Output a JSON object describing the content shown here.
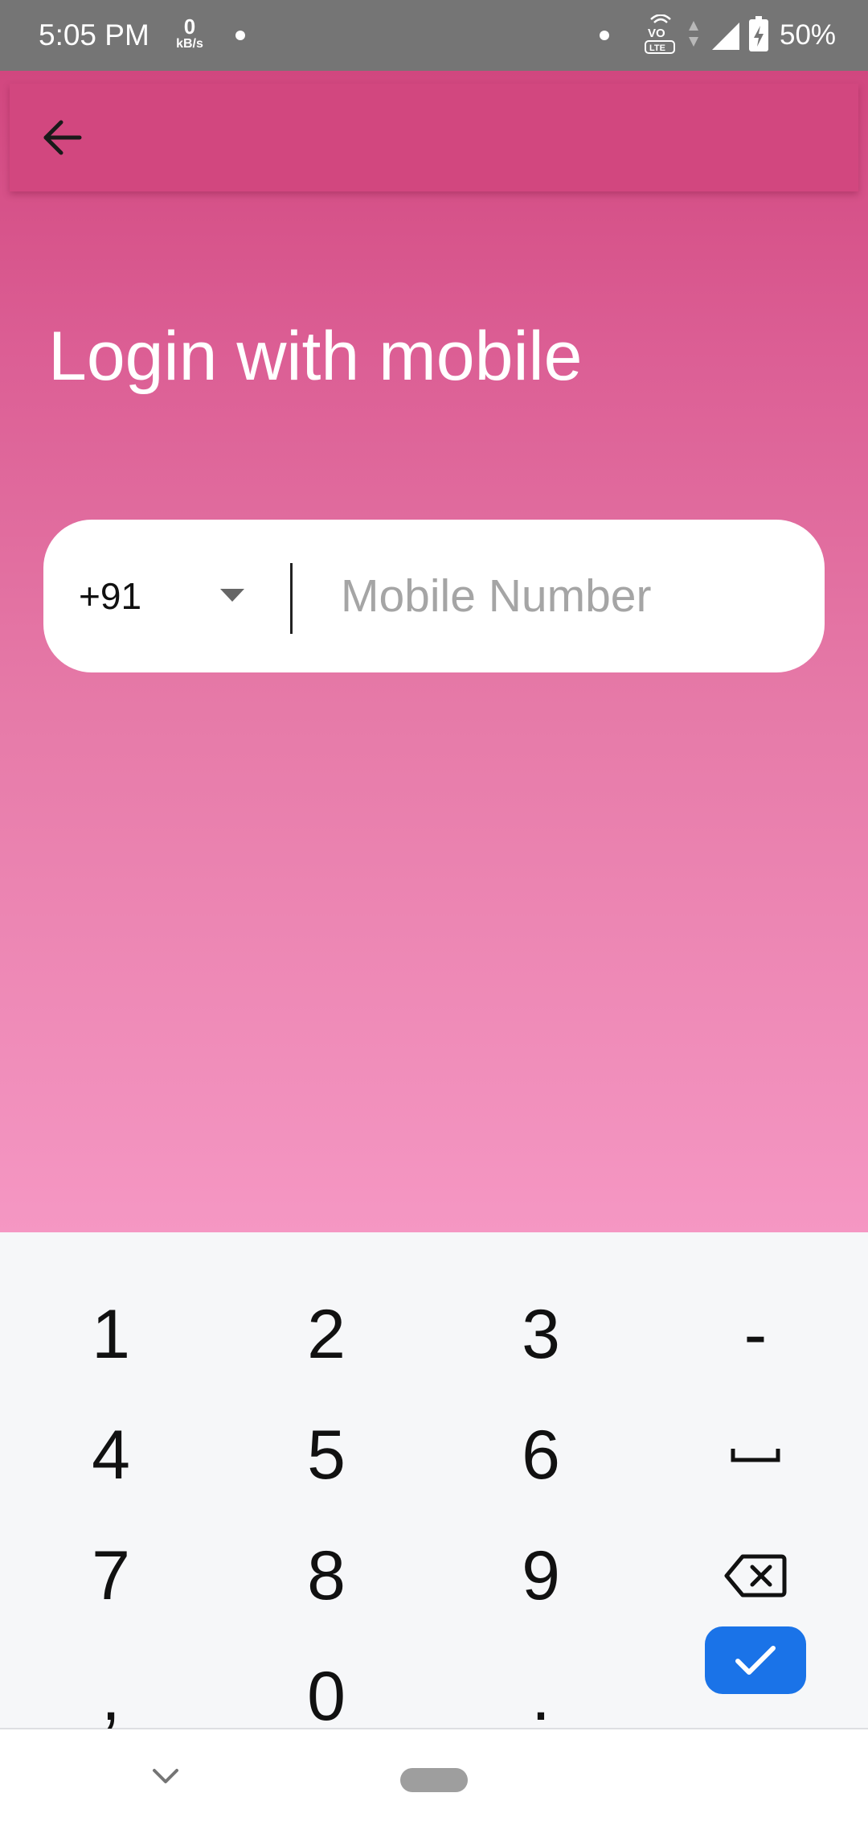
{
  "status_bar": {
    "time": "5:05 PM",
    "net_speed_value": "0",
    "net_speed_unit": "kB/s",
    "volte_line1": "VO",
    "volte_line2": "LTE",
    "battery_percent": "50%",
    "icons": [
      "notification-dot-icon",
      "volte-icon",
      "data-arrows-icon",
      "signal-icon",
      "battery-charging-icon"
    ]
  },
  "app_bar": {
    "back_icon": "arrow-left-icon"
  },
  "login": {
    "title": "Login with mobile",
    "country_code": "+91",
    "dropdown_icon": "caret-down-icon",
    "mobile_placeholder": "Mobile Number",
    "mobile_value": ""
  },
  "keyboard": {
    "rows": [
      [
        "1",
        "2",
        "3",
        "-"
      ],
      [
        "4",
        "5",
        "6",
        "space"
      ],
      [
        "7",
        "8",
        "9",
        "backspace"
      ],
      [
        ",",
        "0",
        ".",
        "done"
      ]
    ],
    "key_1": "1",
    "key_2": "2",
    "key_3": "3",
    "key_minus": "-",
    "key_4": "4",
    "key_5": "5",
    "key_6": "6",
    "key_7": "7",
    "key_8": "8",
    "key_9": "9",
    "key_comma": ",",
    "key_0": "0",
    "key_period": ".",
    "space_icon": "space-bar-icon",
    "backspace_icon": "backspace-icon",
    "done_icon": "checkmark-icon"
  },
  "nav_bar": {
    "icons": [
      "chevron-down-icon",
      "home-pill-icon"
    ]
  },
  "colors": {
    "status_bar": "#757575",
    "app_bar": "#d2477f",
    "gradient_top": "#d1477f",
    "gradient_bottom": "#f597c3",
    "keyboard_bg": "#f6f7f9",
    "done_key": "#1a73e8"
  }
}
